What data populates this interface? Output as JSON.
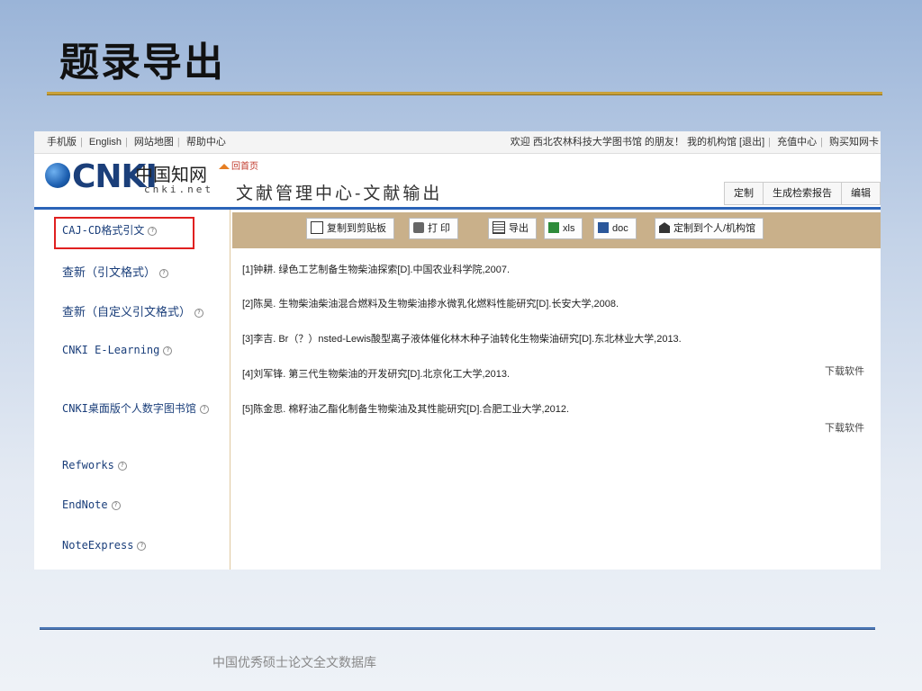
{
  "slide": {
    "title": "题录导出",
    "footer": "中国优秀硕士论文全文数据库"
  },
  "topbar": {
    "left_links": [
      "手机版",
      "English",
      "网站地图",
      "帮助中心"
    ],
    "welcome": "欢迎  西北农林科技大学图书馆 的朋友！",
    "right_links": [
      "我的机构馆",
      "[退出]",
      "充值中心",
      "购买知网卡"
    ]
  },
  "header": {
    "logo_text": "CNKI",
    "logo_cn": "中国知网",
    "logo_net": "cnki.net",
    "home_link": "回首页",
    "title": "文献管理中心-文献输出",
    "tabs": [
      "定制",
      "生成检索报告",
      "编辑"
    ]
  },
  "sidebar": {
    "items": [
      {
        "label": "CAJ-CD格式引文",
        "active": true
      },
      {
        "label": "查新（引文格式）"
      },
      {
        "label": "查新（自定义引文格式）"
      },
      {
        "label": "CNKI E-Learning",
        "sub": "下载软件"
      },
      {
        "label": "CNKI桌面版个人数字图书馆",
        "sub": "下载软件"
      },
      {
        "label": "Refworks"
      },
      {
        "label": "EndNote"
      },
      {
        "label": "NoteExpress"
      }
    ]
  },
  "toolbar": {
    "copy": "复制到剪贴板",
    "print": "打 印",
    "export": "导出",
    "xls": "xls",
    "doc": "doc",
    "custom": "定制到个人/机构馆"
  },
  "results": [
    "[1]钟耕. 绿色工艺制备生物柴油探索[D].中国农业科学院,2007.",
    "[2]陈昊. 生物柴油柴油混合燃料及生物柴油掺水微乳化燃料性能研究[D].长安大学,2008.",
    "[3]李吉. Br（？）nsted-Lewis酸型离子液体催化林木种子油转化生物柴油研究[D].东北林业大学,2013.",
    "[4]刘军锋. 第三代生物柴油的开发研究[D].北京化工大学,2013.",
    "[5]陈金思. 棉籽油乙酯化制备生物柴油及其性能研究[D].合肥工业大学,2012."
  ]
}
